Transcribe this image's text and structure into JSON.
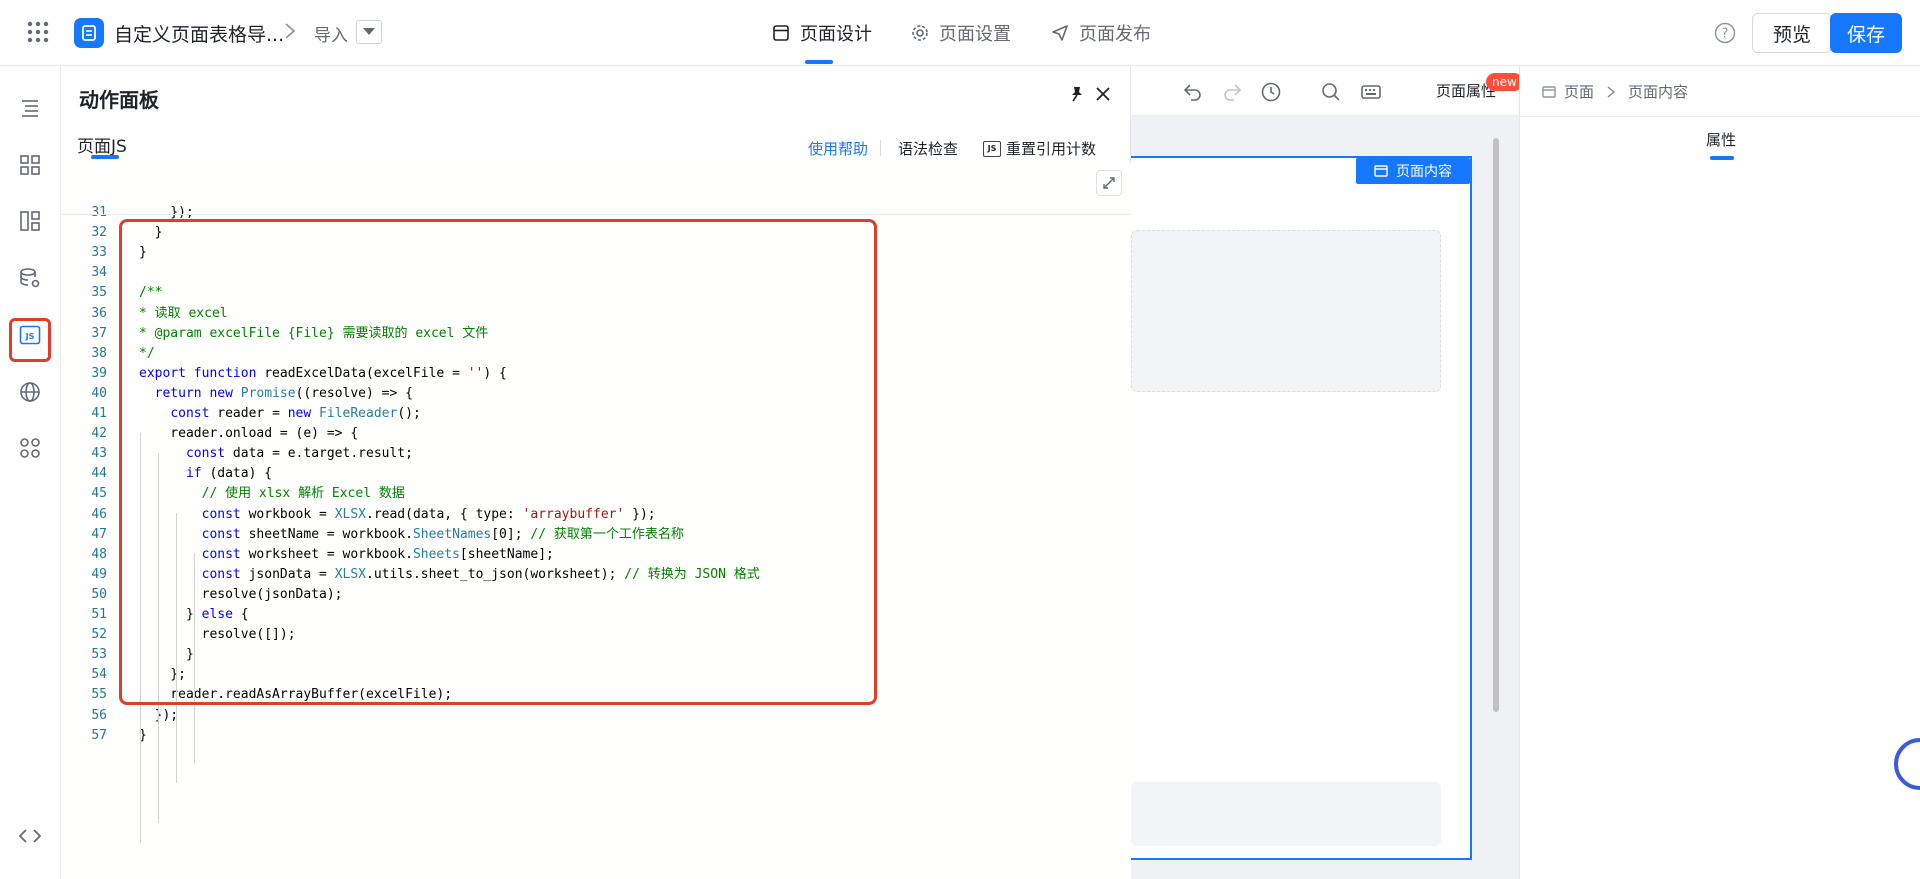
{
  "header": {
    "app_title": "自定义页面表格导...",
    "import_label": "导入",
    "tabs": [
      {
        "label": "页面设计",
        "icon": "layout-icon"
      },
      {
        "label": "页面设置",
        "icon": "gear-icon"
      },
      {
        "label": "页面发布",
        "icon": "send-icon"
      }
    ],
    "preview_label": "预览",
    "save_label": "保存"
  },
  "panel": {
    "title": "动作面板",
    "tab_label": "页面JS",
    "help_label": "使用帮助",
    "lint_label": "语法检查",
    "reset_label": "重置引用计数",
    "js_badge": "JS"
  },
  "editor": {
    "lines": [
      {
        "n": "31",
        "html": "    });"
      },
      {
        "n": "32",
        "html": "  }"
      },
      {
        "n": "33",
        "html": "}"
      },
      {
        "n": "34",
        "html": ""
      },
      {
        "n": "35",
        "html": "<span class=\"c-com\">/**</span>"
      },
      {
        "n": "36",
        "html": "<span class=\"c-com\">* 读取 excel</span>"
      },
      {
        "n": "37",
        "html": "<span class=\"c-com\">* @param excelFile {File} 需要读取的 excel 文件</span>"
      },
      {
        "n": "38",
        "html": "<span class=\"c-com\">*/</span>"
      },
      {
        "n": "39",
        "html": "<span class=\"c-kw\">export function</span> readExcelData(excelFile = <span class=\"c-str\">''</span>) {"
      },
      {
        "n": "40",
        "html": "  <span class=\"c-kw\">return new</span> <span class=\"c-type\">Promise</span>((resolve) =&gt; {"
      },
      {
        "n": "41",
        "html": "    <span class=\"c-kw\">const</span> reader = <span class=\"c-kw\">new</span> <span class=\"c-type\">FileReader</span>();"
      },
      {
        "n": "42",
        "html": "    reader.onload = (e) =&gt; {"
      },
      {
        "n": "43",
        "html": "      <span class=\"c-kw\">const</span> data = e.target.result;"
      },
      {
        "n": "44",
        "html": "      <span class=\"c-kw\">if</span> (data) {"
      },
      {
        "n": "45",
        "html": "        <span class=\"c-com\">// 使用 xlsx 解析 Excel 数据</span>"
      },
      {
        "n": "46",
        "html": "        <span class=\"c-kw\">const</span> workbook = <span class=\"c-type\">XLSX</span>.read(data, { type: <span class=\"c-str\">'arraybuffer'</span> });"
      },
      {
        "n": "47",
        "html": "        <span class=\"c-kw\">const</span> sheetName = workbook.<span class=\"c-type\">SheetNames</span>[0]; <span class=\"c-com\">// 获取第一个工作表名称</span>"
      },
      {
        "n": "48",
        "html": "        <span class=\"c-kw\">const</span> worksheet = workbook.<span class=\"c-type\">Sheets</span>[sheetName];"
      },
      {
        "n": "49",
        "html": "        <span class=\"c-kw\">const</span> jsonData = <span class=\"c-type\">XLSX</span>.utils.sheet_to_json(worksheet); <span class=\"c-com\">// 转换为 JSON 格式</span>"
      },
      {
        "n": "50",
        "html": "        resolve(jsonData);"
      },
      {
        "n": "51",
        "html": "      } <span class=\"c-kw\">else</span> {"
      },
      {
        "n": "52",
        "html": "        resolve([]);"
      },
      {
        "n": "53",
        "html": "      }"
      },
      {
        "n": "54",
        "html": "    };"
      },
      {
        "n": "55",
        "html": "    reader.readAsArrayBuffer(excelFile);"
      },
      {
        "n": "56",
        "html": "  });"
      },
      {
        "n": "57",
        "html": "}"
      }
    ]
  },
  "canvas": {
    "page_props_label": "页面属性",
    "new_badge": "new",
    "content_tag": "页面内容"
  },
  "right_panel": {
    "breadcrumb_root": "页面",
    "breadcrumb_current": "页面内容",
    "tab_label": "属性"
  },
  "colors": {
    "accent": "#1677ff",
    "highlight": "#e03e2d",
    "badge": "#ff4d3a"
  }
}
